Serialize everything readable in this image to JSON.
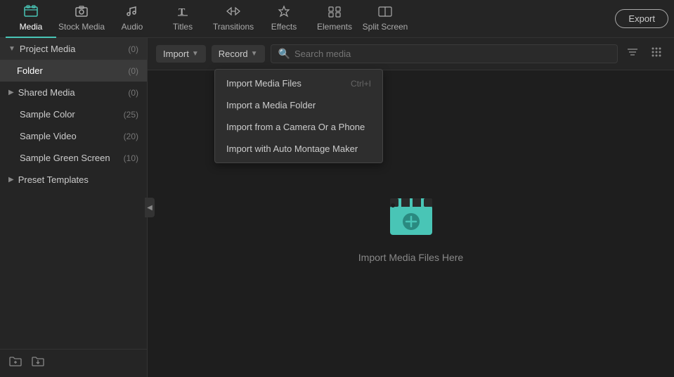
{
  "nav": {
    "items": [
      {
        "id": "media",
        "label": "Media",
        "icon": "🖥",
        "active": true
      },
      {
        "id": "stock-media",
        "label": "Stock Media",
        "icon": "📷"
      },
      {
        "id": "audio",
        "label": "Audio",
        "icon": "♪"
      },
      {
        "id": "titles",
        "label": "Titles",
        "icon": "T"
      },
      {
        "id": "transitions",
        "label": "Transitions",
        "icon": "↔"
      },
      {
        "id": "effects",
        "label": "Effects",
        "icon": "✦"
      },
      {
        "id": "elements",
        "label": "Elements",
        "icon": "⬡"
      },
      {
        "id": "split-screen",
        "label": "Split Screen",
        "icon": "▦"
      }
    ],
    "export_label": "Export"
  },
  "sidebar": {
    "sections": [
      {
        "id": "project-media",
        "label": "Project Media",
        "count": "(0)",
        "expanded": true,
        "children": [
          {
            "id": "folder",
            "label": "Folder",
            "count": "(0)",
            "selected": true
          }
        ]
      },
      {
        "id": "shared-media",
        "label": "Shared Media",
        "count": "(0)",
        "expanded": false
      },
      {
        "id": "sample-color",
        "label": "Sample Color",
        "count": "(25)"
      },
      {
        "id": "sample-video",
        "label": "Sample Video",
        "count": "(20)"
      },
      {
        "id": "sample-green-screen",
        "label": "Sample Green Screen",
        "count": "(10)"
      },
      {
        "id": "preset-templates",
        "label": "Preset Templates",
        "count": "",
        "has_arrow": true
      }
    ],
    "bottom_icons": [
      "new-folder-icon",
      "import-icon"
    ]
  },
  "toolbar": {
    "import_label": "Import",
    "record_label": "Record",
    "search_placeholder": "Search media"
  },
  "dropdown": {
    "items": [
      {
        "id": "import-media-files",
        "label": "Import Media Files",
        "shortcut": "Ctrl+I"
      },
      {
        "id": "import-media-folder",
        "label": "Import a Media Folder",
        "shortcut": ""
      },
      {
        "id": "import-camera-phone",
        "label": "Import from a Camera Or a Phone",
        "shortcut": ""
      },
      {
        "id": "import-auto-montage",
        "label": "Import with Auto Montage Maker",
        "shortcut": ""
      }
    ]
  },
  "content": {
    "empty_label": "Import Media Files Here"
  },
  "colors": {
    "accent": "#49c5b6",
    "active_nav_border": "#49c5b6",
    "clapperboard_body": "#49c5b6",
    "clapperboard_stripe": "#2a8a80"
  }
}
